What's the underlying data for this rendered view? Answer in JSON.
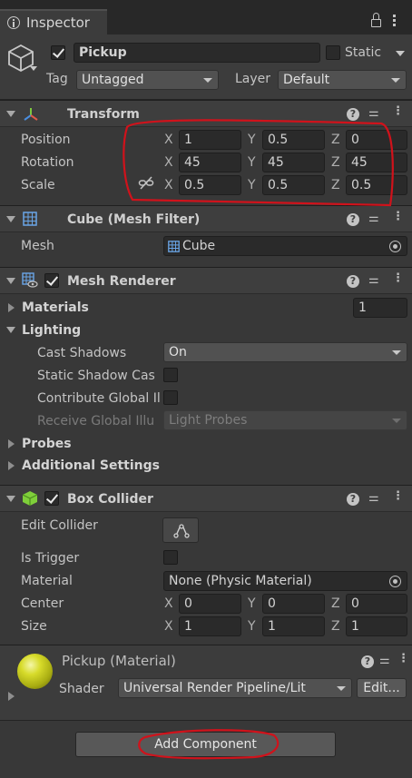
{
  "tab": {
    "title": "Inspector"
  },
  "object": {
    "name": "Pickup",
    "active": true,
    "static_label": "Static",
    "tag_label": "Tag",
    "tag_value": "Untagged",
    "layer_label": "Layer",
    "layer_value": "Default"
  },
  "transform": {
    "title": "Transform",
    "position": {
      "label": "Position",
      "x": "1",
      "y": "0.5",
      "z": "0"
    },
    "rotation": {
      "label": "Rotation",
      "x": "45",
      "y": "45",
      "z": "45"
    },
    "scale": {
      "label": "Scale",
      "x": "0.5",
      "y": "0.5",
      "z": "0.5"
    },
    "axes": {
      "x": "X",
      "y": "Y",
      "z": "Z"
    }
  },
  "mesh_filter": {
    "title": "Cube (Mesh Filter)",
    "mesh_label": "Mesh",
    "mesh_value": "Cube"
  },
  "mesh_renderer": {
    "title": "Mesh Renderer",
    "enabled": true,
    "materials_label": "Materials",
    "materials_count": "1",
    "lighting_label": "Lighting",
    "cast_shadows_label": "Cast Shadows",
    "cast_shadows_value": "On",
    "static_shadow_label": "Static Shadow Cas",
    "contribute_gi_label": "Contribute Global Il",
    "receive_gi_label": "Receive Global Illu",
    "receive_gi_value": "Light Probes",
    "probes_label": "Probes",
    "additional_settings_label": "Additional Settings"
  },
  "box_collider": {
    "title": "Box Collider",
    "enabled": true,
    "edit_collider_label": "Edit Collider",
    "is_trigger_label": "Is Trigger",
    "material_label": "Material",
    "material_value": "None (Physic Material)",
    "center": {
      "label": "Center",
      "x": "0",
      "y": "0",
      "z": "0"
    },
    "size": {
      "label": "Size",
      "x": "1",
      "y": "1",
      "z": "1"
    }
  },
  "material": {
    "title": "Pickup (Material)",
    "shader_label": "Shader",
    "shader_value": "Universal Render Pipeline/Lit",
    "edit_label": "Edit..."
  },
  "add_component_label": "Add Component",
  "colors": {
    "annotation": "#d0121b",
    "material_sphere": "#c8cc1c",
    "box_collider_icon": "#7fcf3a"
  }
}
